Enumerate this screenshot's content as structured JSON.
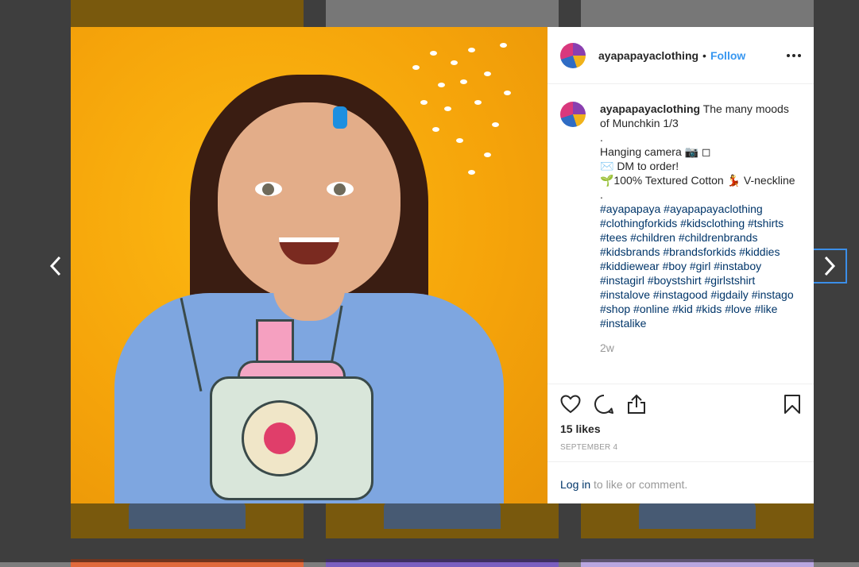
{
  "post": {
    "username": "ayapapayaclothing",
    "separator": "•",
    "follow_label": "Follow",
    "caption": {
      "text_1": "The many moods",
      "text_2": "of Munchkin 1/3",
      "line_dot1": ".",
      "line_hanging": "Hanging camera 📷 ◻",
      "line_dm": "✉️ DM to order!",
      "line_cotton": "🌱100% Textured Cotton 💃 V-neckline",
      "line_dot2": ".",
      "hashtags": [
        "#ayapapaya #ayapapayaclothing",
        "#clothingforkids #kidsclothing #tshirts",
        "#tees #children #childrenbrands",
        "#kidsbrands #brandsforkids #kiddies",
        "#kiddiewear #boy #girl #instaboy",
        "#instagirl #boystshirt #girlstshirt",
        "#instalove #instagood #igdaily #instago",
        "#shop #online #kid #kids #love #like",
        "#instalike"
      ],
      "time_ago": "2w"
    },
    "likes": "15 likes",
    "date": "SEPTEMBER 4",
    "login_link": "Log in",
    "login_rest": " to like or comment."
  },
  "icons": {
    "prev": "chevron-left-icon",
    "next": "chevron-right-icon",
    "like": "heart-icon",
    "comment": "comment-icon",
    "share": "share-icon",
    "save": "bookmark-icon",
    "more": "more-options-icon"
  },
  "colors": {
    "link": "#3897f0",
    "hashtag": "#003569",
    "photo_background": "#f5a30a"
  }
}
